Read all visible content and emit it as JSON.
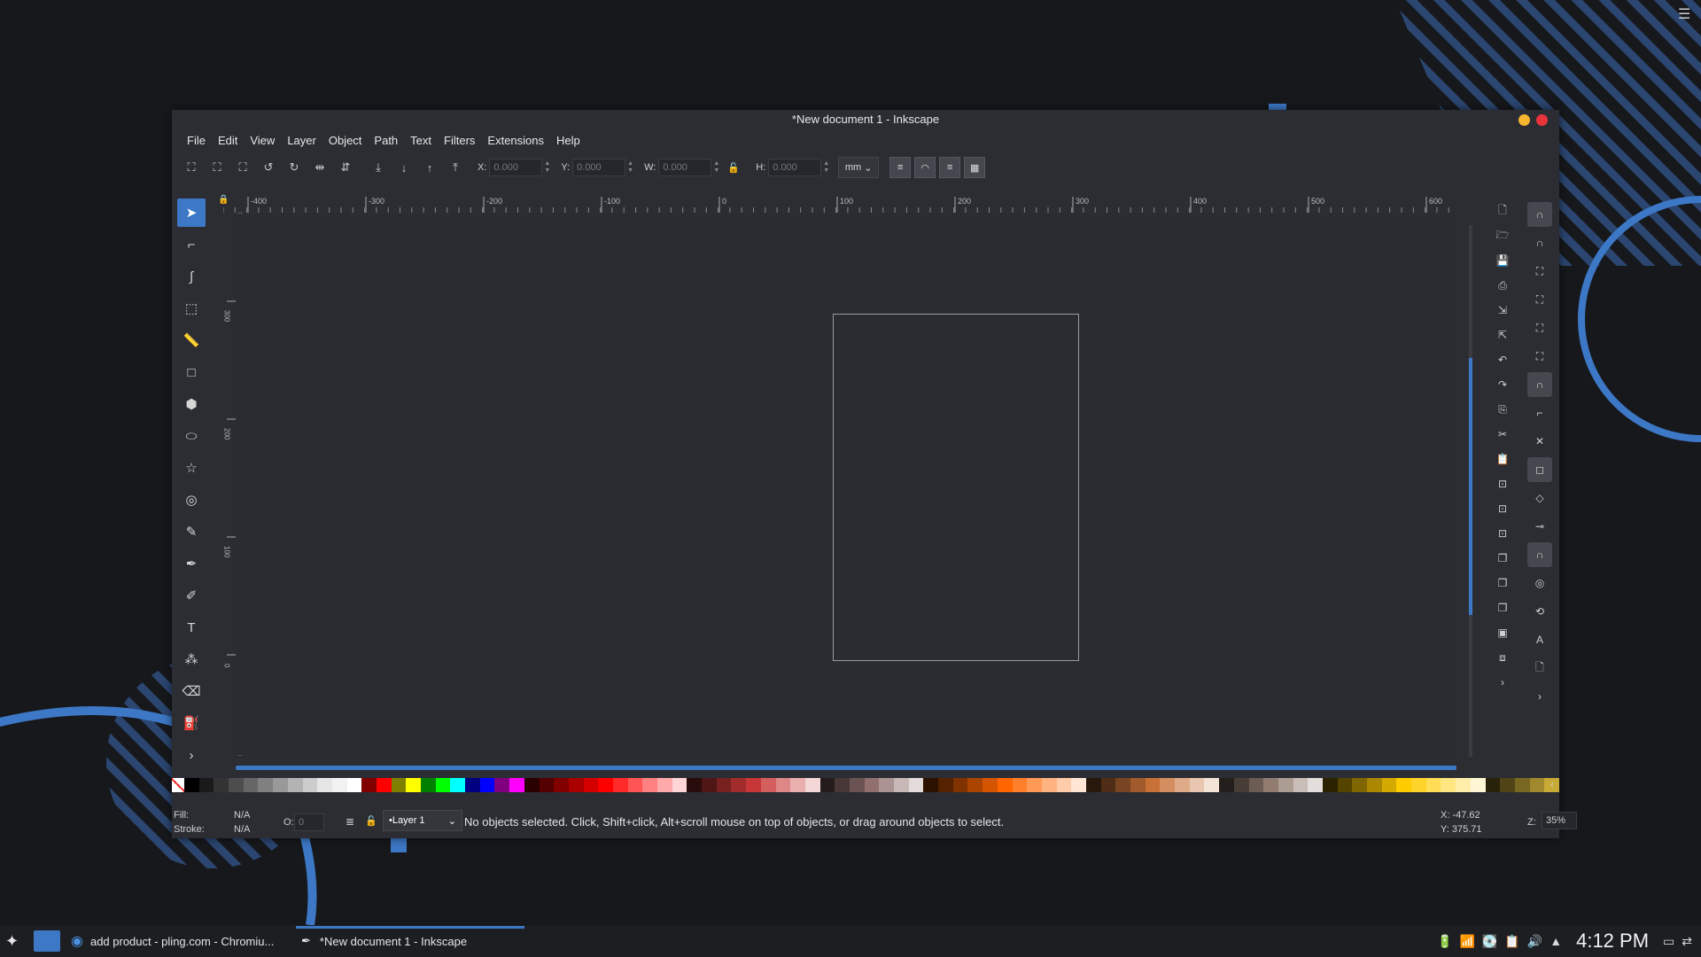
{
  "window": {
    "title": "*New document 1 - Inkscape",
    "menu": [
      "File",
      "Edit",
      "View",
      "Layer",
      "Object",
      "Path",
      "Text",
      "Filters",
      "Extensions",
      "Help"
    ]
  },
  "controls": {
    "x_label": "X:",
    "x_value": "0.000",
    "y_label": "Y:",
    "y_value": "0.000",
    "w_label": "W:",
    "w_value": "0.000",
    "h_label": "H:",
    "h_value": "0.000",
    "unit": "mm"
  },
  "ruler": {
    "top_labels": [
      "-400",
      "-300",
      "-200",
      "-100",
      "0",
      "100",
      "200",
      "300",
      "400",
      "500",
      "600"
    ],
    "left_labels": [
      "300",
      "200",
      "100",
      "0"
    ]
  },
  "status": {
    "fill_label": "Fill:",
    "fill_value": "N/A",
    "stroke_label": "Stroke:",
    "stroke_value": "N/A",
    "opacity_label": "O:",
    "opacity_value": "0",
    "layer": "•Layer 1",
    "message": "No objects selected. Click, Shift+click, Alt+scroll mouse on top of objects, or drag around objects to select.",
    "cursor_x": "X: -47.62",
    "cursor_y": "Y: 375.71",
    "zoom_label": "Z:",
    "zoom": "35%"
  },
  "taskbar": {
    "tasks": [
      "add product - pling.com - Chromiu...",
      "*New document 1 - Inkscape"
    ],
    "clock": "4:12 PM"
  },
  "colors": {
    "accent": "#3d78c6",
    "window_bg": "#2b2d33",
    "desktop_bg": "#16181c",
    "close": "#e8343a",
    "minimize": "#f5b52e"
  },
  "palette": [
    "#000000",
    "#1a1a1a",
    "#333333",
    "#4d4d4d",
    "#666666",
    "#808080",
    "#999999",
    "#b3b3b3",
    "#cccccc",
    "#e6e6e6",
    "#f2f2f2",
    "#ffffff",
    "#800000",
    "#ff0000",
    "#808000",
    "#ffff00",
    "#008000",
    "#00ff00",
    "#00ffff",
    "#000080",
    "#0000ff",
    "#800080",
    "#ff00ff",
    "#2b0000",
    "#550000",
    "#800000",
    "#aa0000",
    "#d40000",
    "#ff0000",
    "#ff2a2a",
    "#ff5555",
    "#ff8080",
    "#ffaaaa",
    "#ffd5d5",
    "#280b0b",
    "#501616",
    "#782121",
    "#a02c2c",
    "#c83737",
    "#d35f5f",
    "#de8787",
    "#e9afaf",
    "#f4d7d7",
    "#241c1c",
    "#483737",
    "#6c5353",
    "#916f6f",
    "#ac9393",
    "#c8b7b7",
    "#e3dbdb",
    "#2b1100",
    "#552200",
    "#803300",
    "#aa4400",
    "#d45500",
    "#ff6600",
    "#ff7f2a",
    "#ff9955",
    "#ffb380",
    "#ffccaa",
    "#ffe6d5",
    "#28170b",
    "#502d16",
    "#784421",
    "#a05a2c",
    "#c87137",
    "#d38d5f",
    "#deaa87",
    "#e9c6af",
    "#f4e3d7",
    "#241f1c",
    "#483e37",
    "#6c5d53",
    "#917c6f",
    "#ac9d93",
    "#c8beb7",
    "#e3dedb",
    "#2b2200",
    "#554400",
    "#806600",
    "#aa8800",
    "#d4aa00",
    "#ffcc00",
    "#ffd42a",
    "#ffdd55",
    "#ffe680",
    "#ffeeaa",
    "#fff6d5",
    "#28220b",
    "#504416",
    "#786721",
    "#a0892c",
    "#c8ab37"
  ]
}
